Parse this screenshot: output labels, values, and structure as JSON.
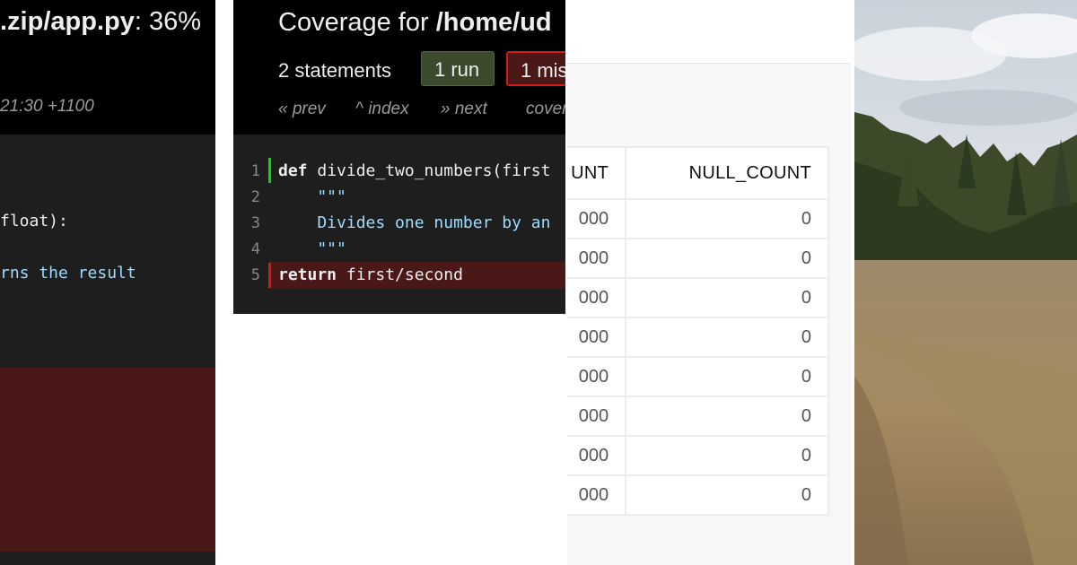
{
  "left_panel": {
    "title_bold": ".zip/app.py",
    "title_rest": ": 36%",
    "timestamp": "21:30 +1100",
    "code_lines": [
      {
        "text": "float):",
        "kind": "code"
      },
      {
        "text": "rns the result",
        "kind": "string"
      }
    ],
    "trailing_char": ")"
  },
  "middle_panel": {
    "title_prefix": "Coverage for ",
    "title_path": "/home/ud",
    "statements": "2 statements",
    "run_button": "1 run",
    "missing_button": "1 mis",
    "nav": {
      "prev": "« prev",
      "index": "^ index",
      "next": "» next",
      "coverage": "cover"
    },
    "source_lines": [
      {
        "num": "1",
        "keyword": "def",
        "text": " divide_two_numbers(first",
        "status": "run"
      },
      {
        "num": "2",
        "keyword": "",
        "text": "    \"\"\"",
        "status": "none"
      },
      {
        "num": "3",
        "keyword": "",
        "text": "    Divides one number by an",
        "status": "none"
      },
      {
        "num": "4",
        "keyword": "",
        "text": "    \"\"\"",
        "status": "none"
      },
      {
        "num": "5",
        "keyword": "return",
        "text": " first/second",
        "status": "missing"
      }
    ],
    "colors": {
      "run": "#00dd00",
      "missing": "#d41919"
    }
  },
  "table": {
    "headers": [
      "UNT",
      "NULL_COUNT"
    ],
    "rows": [
      [
        "000",
        "0"
      ],
      [
        "000",
        "0"
      ],
      [
        "000",
        "0"
      ],
      [
        "000",
        "0"
      ],
      [
        "000",
        "0"
      ],
      [
        "000",
        "0"
      ],
      [
        "000",
        "0"
      ],
      [
        "000",
        "0"
      ]
    ]
  },
  "photo": {
    "subject": "grassy-field-with-forest-under-cloudy-sky"
  }
}
